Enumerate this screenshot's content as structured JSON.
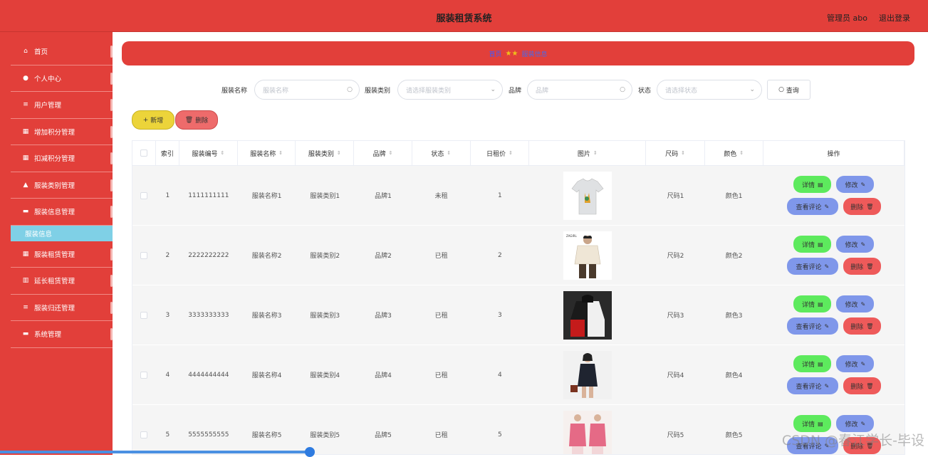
{
  "header": {
    "title": "服装租赁系统",
    "user": "管理员 abo",
    "logout": "退出登录"
  },
  "sidebar": {
    "items": [
      {
        "icon": "home-icon",
        "glyph": "⌂",
        "label": "首页"
      },
      {
        "icon": "person-icon",
        "glyph": "●",
        "label": "个人中心"
      },
      {
        "icon": "list-icon",
        "glyph": "≡",
        "label": "用户管理"
      },
      {
        "icon": "grid-icon",
        "glyph": "▦",
        "label": "增加积分管理"
      },
      {
        "icon": "grid-icon",
        "glyph": "▦",
        "label": "扣减积分管理"
      },
      {
        "icon": "thumb-icon",
        "glyph": "▲",
        "label": "服装类别管理"
      },
      {
        "icon": "monitor-icon",
        "glyph": "▬",
        "label": "服装信息管理"
      }
    ],
    "sub_item": "服装信息",
    "items_after": [
      {
        "icon": "grid-icon",
        "glyph": "▦",
        "label": "服装租赁管理"
      },
      {
        "icon": "bar-chart-icon",
        "glyph": "▥",
        "label": "延长租赁管理"
      },
      {
        "icon": "list-icon",
        "glyph": "≡",
        "label": "服装归还管理"
      },
      {
        "icon": "monitor-icon",
        "glyph": "▬",
        "label": "系统管理"
      }
    ]
  },
  "breadcrumb": {
    "home": "首页",
    "current": "服装信息"
  },
  "search": {
    "name_label": "服装名称",
    "name_placeholder": "服装名称",
    "category_label": "服装类别",
    "category_placeholder": "请选择服装类别",
    "brand_label": "品牌",
    "brand_placeholder": "品牌",
    "status_label": "状态",
    "status_placeholder": "请选择状态",
    "query_label": "查询"
  },
  "actions": {
    "add": "新增",
    "delete": "删除"
  },
  "table": {
    "headers": [
      "索引",
      "服装编号",
      "服装名称",
      "服装类别",
      "品牌",
      "状态",
      "日租价",
      "图片",
      "尺码",
      "颜色",
      "操作"
    ],
    "rows": [
      {
        "index": "1",
        "code": "1111111111",
        "name": "服装名称1",
        "category": "服装类别1",
        "brand": "品牌1",
        "status": "未租",
        "price": "1",
        "size": "尺码1",
        "color": "颜色1",
        "img": "tshirt"
      },
      {
        "index": "2",
        "code": "2222222222",
        "name": "服装名称2",
        "category": "服装类别2",
        "brand": "品牌2",
        "status": "已租",
        "price": "2",
        "size": "尺码2",
        "color": "颜色2",
        "img": "jacket"
      },
      {
        "index": "3",
        "code": "3333333333",
        "name": "服装名称3",
        "category": "服装类别3",
        "brand": "品牌3",
        "status": "已租",
        "price": "3",
        "size": "尺码3",
        "color": "颜色3",
        "img": "hoodie"
      },
      {
        "index": "4",
        "code": "4444444444",
        "name": "服装名称4",
        "category": "服装类别4",
        "brand": "品牌4",
        "status": "已租",
        "price": "4",
        "size": "尺码4",
        "color": "颜色4",
        "img": "dress"
      },
      {
        "index": "5",
        "code": "5555555555",
        "name": "服装名称5",
        "category": "服装类别5",
        "brand": "品牌5",
        "status": "已租",
        "price": "5",
        "size": "尺码5",
        "color": "颜色5",
        "img": "pink"
      }
    ],
    "op_labels": {
      "detail": "详情",
      "edit": "修改",
      "comment": "查看评论",
      "delete": "删除"
    }
  },
  "watermark": "CSDN @春江学长-毕设",
  "colors": {
    "primary": "#e23f3a",
    "submenu": "#7fd0e6",
    "detail": "#5dea5d",
    "edit": "#7f97ea",
    "delete": "#ee5a5a",
    "add": "#ecd43a"
  }
}
